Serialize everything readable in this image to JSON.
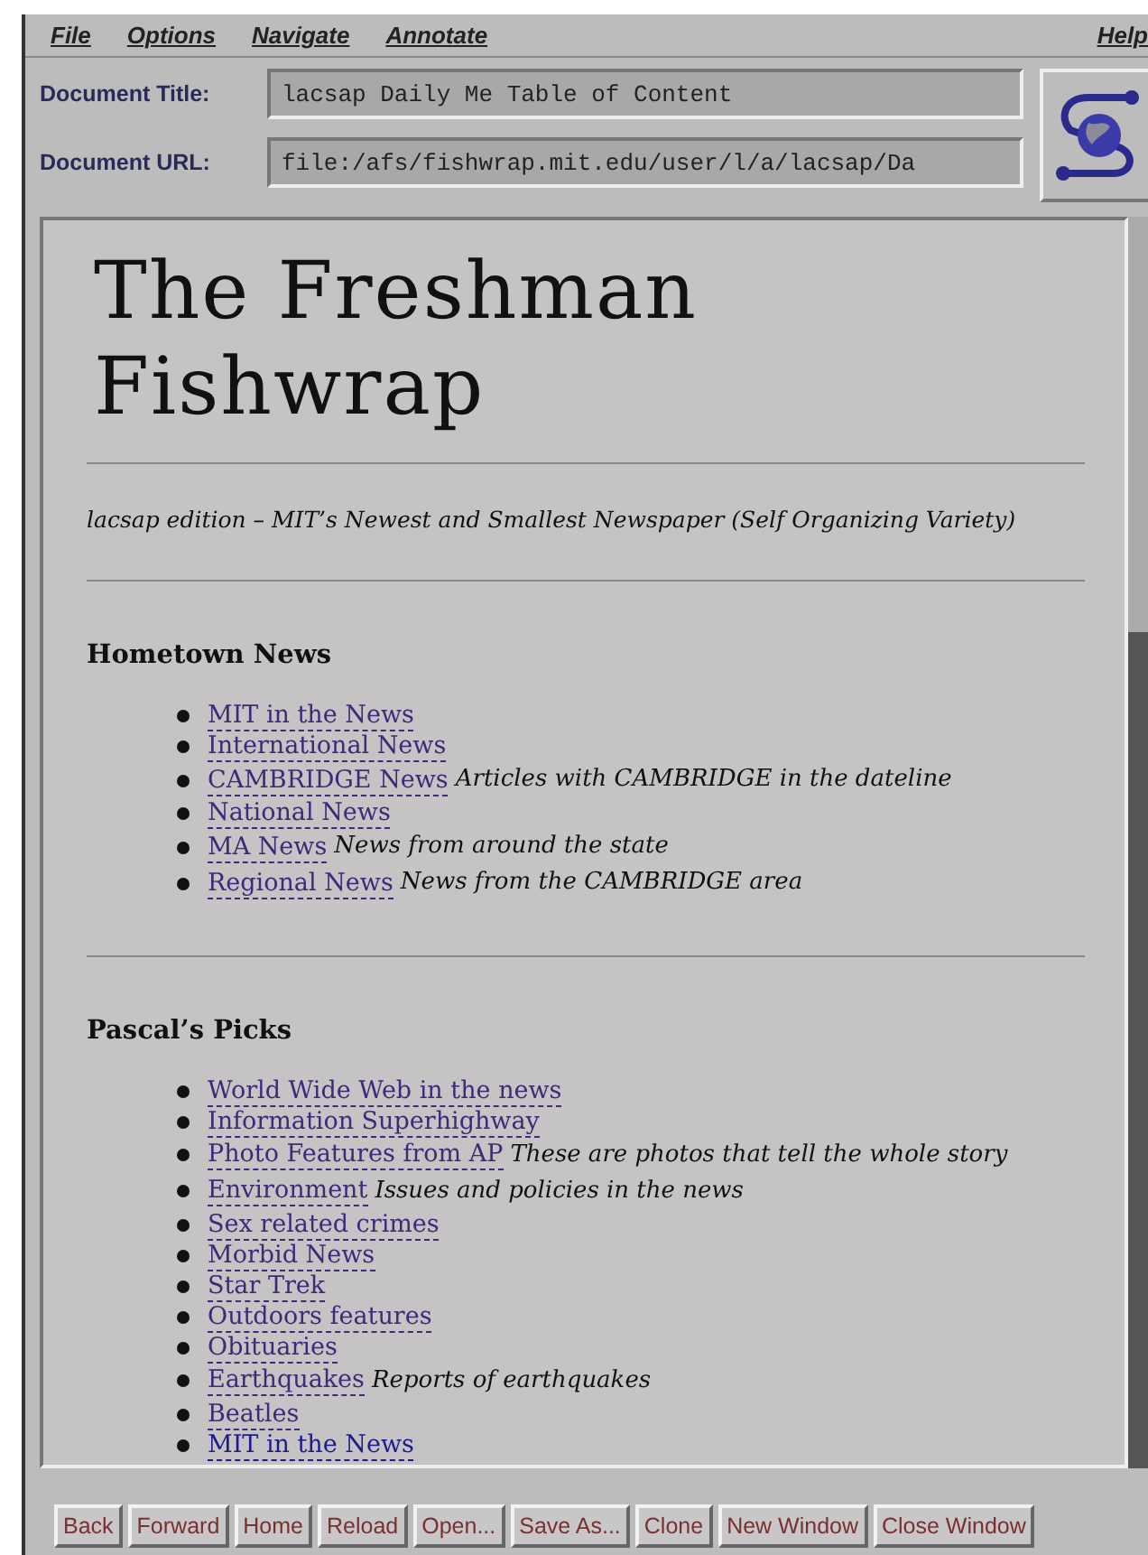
{
  "menu": [
    {
      "label": "File"
    },
    {
      "label": "Options"
    },
    {
      "label": "Navigate"
    },
    {
      "label": "Annotate"
    },
    {
      "label": "Help"
    }
  ],
  "fields": [
    {
      "label": "Document Title:",
      "value": "lacsap Daily Me Table of Content"
    },
    {
      "label": "Document URL:",
      "value": "file:/afs/fishwrap.mit.edu/user/l/a/lacsap/Da"
    }
  ],
  "page": {
    "title": "The Freshman Fishwrap",
    "subtitle": "lacsap edition – MIT’s Newest and Smallest Newspaper (Self Organizing Variety)",
    "sections": [
      {
        "heading": "Hometown News",
        "items": [
          {
            "link": "MIT in the News",
            "visited": true
          },
          {
            "link": "International News",
            "visited": true
          },
          {
            "link": "CAMBRIDGE News",
            "visited": true,
            "note": "Articles with CAMBRIDGE in the dateline"
          },
          {
            "link": "National News",
            "visited": true
          },
          {
            "link": "MA News",
            "visited": true,
            "note": "News from around the state"
          },
          {
            "link": "Regional News",
            "visited": true,
            "note": "News from the CAMBRIDGE area"
          }
        ]
      },
      {
        "heading": "Pascal’s Picks",
        "items": [
          {
            "link": "World Wide Web in the news",
            "visited": true
          },
          {
            "link": "Information Superhighway",
            "visited": true
          },
          {
            "link": "Photo Features from AP",
            "visited": true,
            "note": "These are photos that tell the whole story"
          },
          {
            "link": "Environment",
            "visited": true,
            "note": "Issues and policies in the news"
          },
          {
            "link": "Sex related crimes",
            "visited": true
          },
          {
            "link": "Morbid News",
            "visited": true
          },
          {
            "link": "Star Trek",
            "visited": true
          },
          {
            "link": "Outdoors features",
            "visited": true
          },
          {
            "link": "Obituaries",
            "visited": true
          },
          {
            "link": "Earthquakes",
            "visited": true,
            "note": "Reports of earthquakes"
          },
          {
            "link": "Beatles",
            "visited": true
          },
          {
            "link": "MIT in the News",
            "visited": false
          }
        ]
      }
    ]
  },
  "buttons": [
    {
      "label": "Back"
    },
    {
      "label": "Forward"
    },
    {
      "label": "Home"
    },
    {
      "label": "Reload"
    },
    {
      "label": "Open..."
    },
    {
      "label": "Save As..."
    },
    {
      "label": "Clone"
    },
    {
      "label": "New Window"
    },
    {
      "label": "Close Window"
    }
  ]
}
